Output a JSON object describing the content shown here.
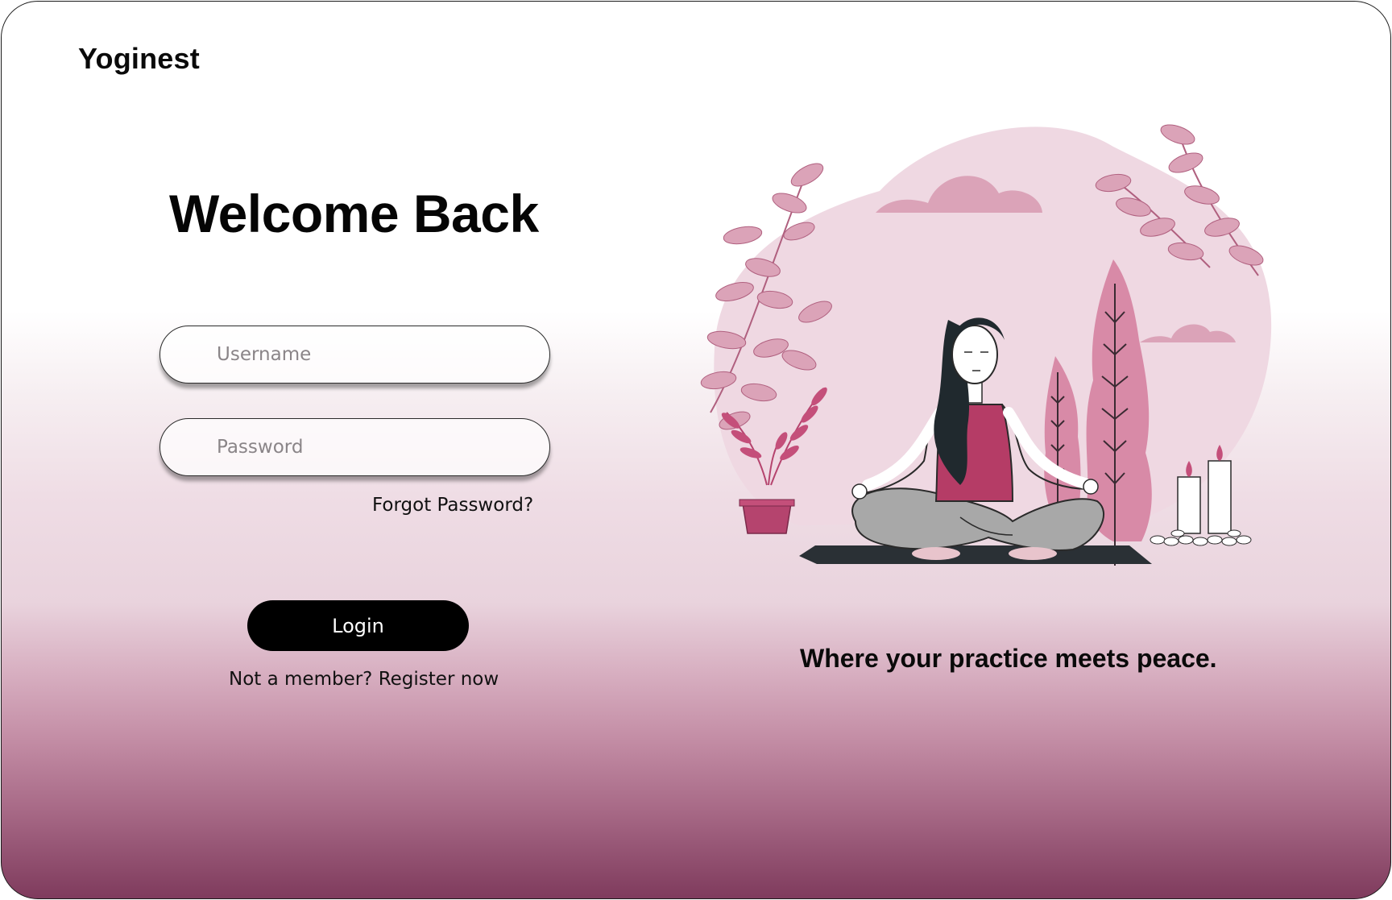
{
  "app": {
    "brand": "Yoginest"
  },
  "login": {
    "heading": "Welcome Back",
    "username_placeholder": "Username",
    "password_placeholder": "Password",
    "forgot_password": "Forgot Password?",
    "login_button": "Login",
    "register_prompt": "Not a member?",
    "register_link": "Register now"
  },
  "hero": {
    "tagline": "Where your practice meets peace.",
    "illustration": "woman-meditating-illustration"
  },
  "colors": {
    "accent_dark": "#7f3b5d",
    "accent_pink": "#b5446e",
    "blob_pink": "#f0d8e2",
    "foliage_pink": "#dba3b8"
  }
}
